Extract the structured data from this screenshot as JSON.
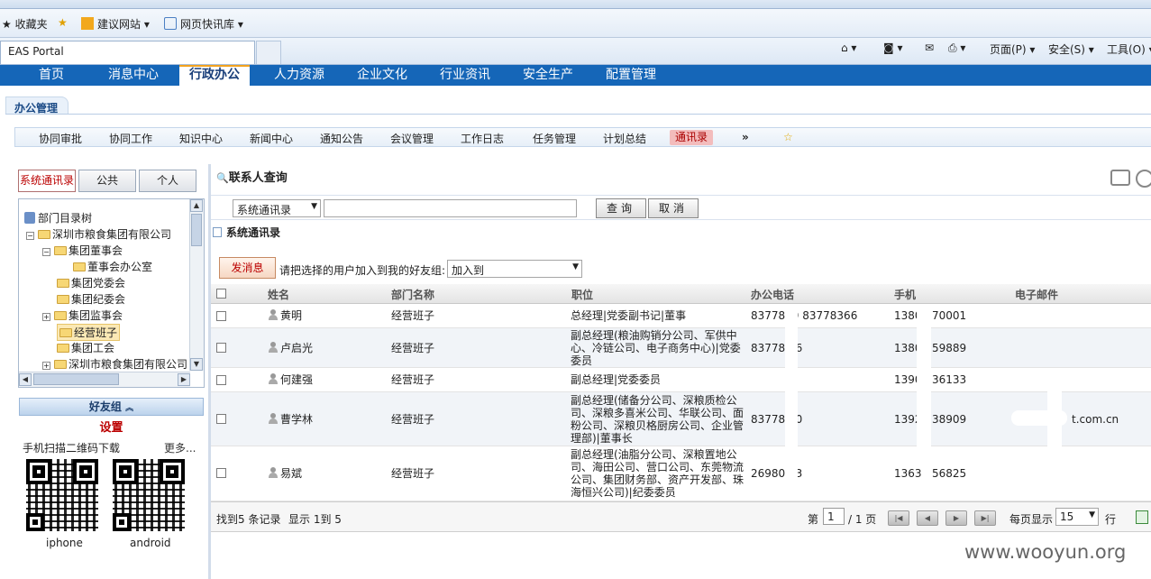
{
  "browser": {
    "favorites_label": "收藏夹",
    "suggested_sites": "建议网站",
    "web_slices": "网页快讯库",
    "tab_title": "EAS Portal",
    "page_menu": "页面(P)",
    "safety_menu": "安全(S)",
    "tools_menu": "工具(O)"
  },
  "main_nav": [
    "首页",
    "消息中心",
    "行政办公",
    "人力资源",
    "企业文化",
    "行业资讯",
    "安全生产",
    "配置管理"
  ],
  "section_title": "办公管理",
  "sub_nav": [
    "协同审批",
    "协同工作",
    "知识中心",
    "新闻中心",
    "通知公告",
    "会议管理",
    "工作日志",
    "任务管理",
    "计划总结",
    "通讯录",
    "»"
  ],
  "left": {
    "tabs": [
      "系统通讯录",
      "公共",
      "个人"
    ],
    "tree": {
      "root": "部门目录树",
      "company": "深圳市粮食集团有限公司",
      "board": "集团董事会",
      "board_office": "董事会办公室",
      "party": "集团党委会",
      "discipline": "集团纪委会",
      "supervisors": "集团监事会",
      "management": "经营班子",
      "union": "集团工会",
      "company2": "深圳市粮食集团有限公司"
    },
    "friend_group": "好友组",
    "settings": "设置",
    "qr_title": "手机扫描二维码下载",
    "more": "更多...",
    "iphone": "iphone",
    "android": "android"
  },
  "query": {
    "title": "联系人查询",
    "select_value": "系统通讯录",
    "input_value": "",
    "search_btn": "查询",
    "cancel_btn": "取消"
  },
  "directory_title": "系统通讯录",
  "send_btn": "发消息",
  "add_tip": "请把选择的用户加入到我的好友组:",
  "add_select": "加入到",
  "table": {
    "headers": [
      "姓名",
      "部门名称",
      "职位",
      "办公电话",
      "手机",
      "电子邮件"
    ],
    "rows": [
      {
        "name": "黄明",
        "dept": "经营班子",
        "position": "总经理|党委副书记|董事",
        "phone": "83778  9 83778366",
        "mobile": "1380   70001",
        "email": ""
      },
      {
        "name": "卢启光",
        "dept": "经营班子",
        "position": "副总经理(粮油购销分公司、军供中心、冷链公司、电子商务中心)|党委委员",
        "phone": "83778   6",
        "mobile": "1380   59889",
        "email": ""
      },
      {
        "name": "何建强",
        "dept": "经营班子",
        "position": "副总经理|党委委员",
        "phone": "",
        "mobile": "1390   36133",
        "email": ""
      },
      {
        "name": "曹学林",
        "dept": "经营班子",
        "position": "副总经理(储备分公司、深粮质检公司、深粮多喜米公司、华联公司、面粉公司、深粮贝格厨房公司、企业管理部)|董事长",
        "phone": "83778   0",
        "mobile": "1392   38909",
        "email": "t.com.cn"
      },
      {
        "name": "易斌",
        "dept": "经营班子",
        "position": "副总经理(油脂分公司、深粮置地公司、海田公司、营口公司、东莞物流公司、集团财务部、资产开发部、珠海恒兴公司)|纪委委员",
        "phone": "26980   3",
        "mobile": "1363   56825",
        "email": ""
      }
    ]
  },
  "footer": {
    "found": "找到5 条记录",
    "display": "显示 1到 5",
    "page_prefix": "第",
    "page": "1",
    "page_total": "/ 1 页",
    "per_page_label": "每页显示",
    "per_page": "15",
    "row_unit": "行"
  },
  "watermark": "www.wooyun.org"
}
